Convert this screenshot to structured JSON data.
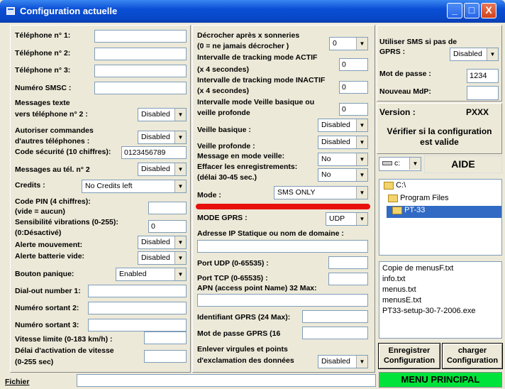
{
  "window": {
    "title": "Configuration actuelle",
    "buttons": {
      "minimize": "_",
      "maximize": "□",
      "close": "X"
    }
  },
  "left": {
    "tel1_label": "Téléphone n° 1:",
    "tel1_value": "",
    "tel2_label": "Téléphone n° 2:",
    "tel2_value": "",
    "tel3_label": "Téléphone n° 3:",
    "tel3_value": "",
    "smsc_label": "Numéro SMSC :",
    "smsc_value": "",
    "msg_texte_label1": "Messages texte",
    "msg_texte_label2": "vers téléphone n° 2 :",
    "msg_texte_value": "Disabled",
    "autoriser_label1": "Autoriser commandes",
    "autoriser_label2": "d'autres téléphones :",
    "autoriser_value": "Disabled",
    "code_label": "Code sécurité (10 chiffres):",
    "code_value": "0123456789",
    "msg_tel2_label": "Messages au tél. n° 2",
    "msg_tel2_value": "Disabled",
    "credits_label": "Credits :",
    "credits_value": "No Credits left",
    "pin_label1": "Code PIN (4 chiffres):",
    "pin_label2": "(vide = aucun)",
    "pin_value": "",
    "sens_label1": "Sensibilité vibrations (0-255):",
    "sens_label2": "(0:Désactivé)",
    "sens_value": "0",
    "alerte_mvt_label": "Alerte mouvement:",
    "alerte_mvt_value": "Disabled",
    "alerte_bat_label": "Alerte batterie vide:",
    "alerte_bat_value": "Disabled",
    "panique_label": "Bouton panique:",
    "panique_value": "Enabled",
    "dialout_label": "Dial-out number 1:",
    "dialout_value": "",
    "sortant2_label": "Numéro sortant 2:",
    "sortant2_value": "",
    "sortant3_label": "Numéro sortant 3:",
    "sortant3_value": "",
    "vitesse_label": "Vitesse limite (0-183 km/h) :",
    "vitesse_value": "",
    "delai_label1": "Délai d'activation de vitesse",
    "delai_label2": "(0-255 sec)",
    "delai_value": ""
  },
  "middle": {
    "decrocher_label1": "Décrocher après x sonneries",
    "decrocher_label2": "(0 = ne jamais décrocher )",
    "decrocher_value": "0",
    "actif_label1": "Intervalle de tracking mode ACTIF",
    "actif_label2": "(x 4 secondes)",
    "actif_value": "0",
    "inactif_label1": "Intervalle de tracking mode INACTIF",
    "inactif_label2": "(x 4 secondes)",
    "inactif_value": "0",
    "veille_int_label1": "Intervalle mode Veille basique ou",
    "veille_int_label2": "veille profonde",
    "veille_int_value": "0",
    "veille_basique_label": "Veille basique :",
    "veille_basique_value": "Disabled",
    "veille_profonde_label": "Veille profonde :",
    "veille_profonde_value": "Disabled",
    "msg_veille_label": "Message en mode veille:",
    "msg_veille_value": "No",
    "effacer_label1": "Effacer les enregistrements:",
    "effacer_label2": "(délai 30-45 sec.)",
    "effacer_value": "No",
    "mode_label": "Mode :",
    "mode_value": "SMS ONLY",
    "gprs_mode_label": "MODE GPRS :",
    "gprs_mode_value": "UDP",
    "ip_label": "Adresse IP Statique ou nom de domaine :",
    "ip_value": "",
    "port_udp_label": "Port UDP  (0-65535) :",
    "port_udp_value": "",
    "port_tcp_label": "Port TCP (0-65535) :",
    "port_tcp_value": "",
    "apn_label": "APN (access point Name) 32 Max:",
    "apn_value": "",
    "ident_label": "Identifiant GPRS (24 Max):",
    "ident_value": "",
    "mdp_gprs_label": "Mot de passe GPRS (16",
    "mdp_gprs_value": "",
    "enlever_label1": "Enlever virgules et points",
    "enlever_label2": "d'exclamation des données",
    "enlever_value": "Disabled"
  },
  "right": {
    "sms_gprs_label1": "Utiliser SMS si pas de",
    "sms_gprs_label2": "GPRS :",
    "sms_gprs_value": "Disabled",
    "mdp_label": "Mot de passe :",
    "mdp_value": "1234",
    "nouveau_mdp_label": "Nouveau MdP:",
    "nouveau_mdp_value": "",
    "version_label": "Version :",
    "version_value": "PXXX",
    "verify_button": "Vérifier si la configuration est valide",
    "drive_value": "c:",
    "aide_button": "AIDE",
    "folders": [
      "C:\\",
      "Program Files",
      "PT-33"
    ],
    "files": [
      "Copie de menusF.txt",
      "info.txt",
      "menus.txt",
      "menusE.txt",
      "PT33-setup-30-7-2006.exe"
    ],
    "enregistrer_button": "Enregistrer Configuration",
    "charger_button": "charger Configuration",
    "menu_principal_button": "MENU PRINCIPAL"
  },
  "footer": {
    "fichier_label": "Fichier",
    "fichier_value": ""
  },
  "colors": {
    "title_bar": "#0A4FD6",
    "red_divider": "#E8100C",
    "menu_principal_bg": "#00E33B",
    "selection": "#316AC5"
  }
}
